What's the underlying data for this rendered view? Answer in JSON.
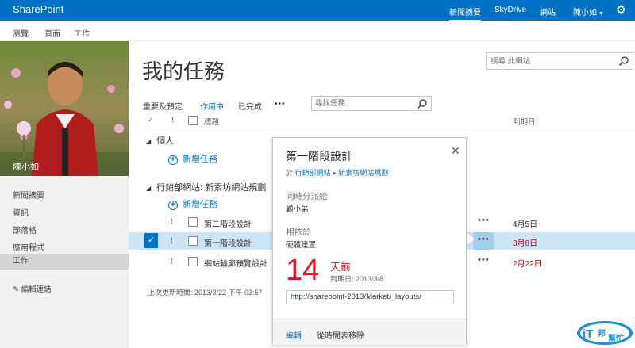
{
  "suite": {
    "brand": "SharePoint",
    "nav": [
      {
        "label": "新聞摘要"
      },
      {
        "label": "SkyDrive"
      },
      {
        "label": "網站"
      }
    ],
    "user": "陳小如",
    "settings_icon": "gear-icon"
  },
  "ribbon": {
    "tabs": [
      "瀏覽",
      "頁面",
      "工作"
    ]
  },
  "left": {
    "profile_name": "陳小如",
    "nav": [
      "新聞摘要",
      "資訊",
      "部落格",
      "應用程式",
      "工作"
    ],
    "selected": "工作",
    "edit_links": "編輯連結"
  },
  "main": {
    "title": "我的任務",
    "site_search_placeholder": "搜尋 此網站",
    "filters": [
      "重要及預定",
      "作用中",
      "已完成"
    ],
    "more": "•••",
    "task_search_placeholder": "尋找任務",
    "columns": {
      "check": "✓",
      "important": "!",
      "title": "標題",
      "due": "到期日"
    },
    "groups": [
      {
        "label": "個人",
        "add": "新增任務"
      },
      {
        "label": "行銷部網站: 新素坊網站規劃",
        "add": "新增任務"
      }
    ],
    "rows": [
      {
        "title": "第二階段設計",
        "due": "4月5日",
        "overdue": false
      },
      {
        "title": "第一階段設計",
        "due": "3月8日",
        "overdue": true
      },
      {
        "title": "網站輪廓預覽設計",
        "due": "2月22日",
        "overdue": true
      }
    ],
    "updated": "上次更新時間: 2013/3/22 下午 03:57"
  },
  "callout": {
    "title": "第一階段設計",
    "breadcrumb_prefix": "於",
    "breadcrumb_site": "行銷部網站",
    "breadcrumb_sep": "▸",
    "breadcrumb_list": "新素坊網站規劃",
    "assigned_label": "同時分派給",
    "assigned_value": "顧小弟",
    "related_label": "相依於",
    "related_value": "硬體建置",
    "days": "14",
    "days_ago": "天前",
    "due_line": "到期日: 2013/3/8",
    "url": "http://sharepoint-2013/Market/_layouts/",
    "edit": "編輯",
    "remove": "從時間表移除"
  },
  "watermark": {
    "main": "iT",
    "sub": "邦",
    "sub2": "幫忙"
  },
  "colors": {
    "suite": "#0072c6",
    "accent": "#0072c6",
    "overdue": "#c00000",
    "big_days": "#e81123",
    "selected_row": "#cde6f7"
  }
}
